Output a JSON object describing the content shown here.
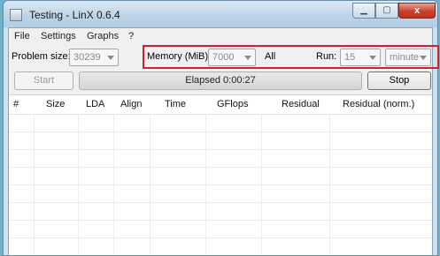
{
  "window": {
    "title": "Testing - LinX 0.6.4",
    "controls": {
      "close": "x"
    }
  },
  "menu": [
    "File",
    "Settings",
    "Graphs",
    "?"
  ],
  "problem_size": {
    "label": "Problem size:",
    "value": "30239"
  },
  "memory": {
    "label": "Memory (MiB):",
    "value": "7000",
    "all_label": "All"
  },
  "run": {
    "label": "Run:",
    "value": "15",
    "unit": "minute"
  },
  "buttons": {
    "start": "Start",
    "stop": "Stop"
  },
  "status": {
    "elapsed": "Elapsed 0:00:27"
  },
  "table": {
    "columns": [
      "#",
      "Size",
      "LDA",
      "Align",
      "Time",
      "GFlops",
      "Residual",
      "Residual (norm.)"
    ]
  },
  "colors": {
    "highlight": "#d11f2c",
    "desktop": "#6fb2c8"
  }
}
